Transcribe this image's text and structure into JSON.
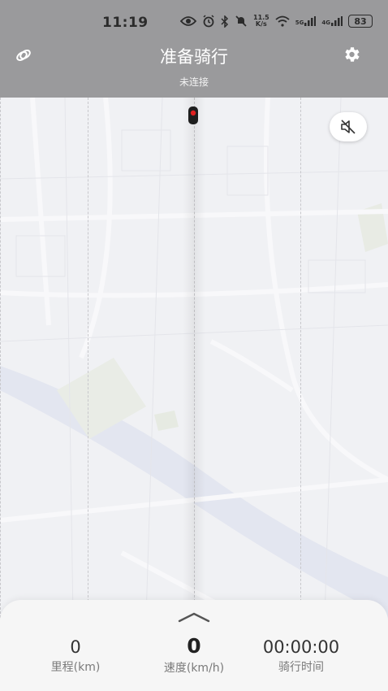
{
  "status": {
    "time": "11:19",
    "net_speed_top": "11.5",
    "net_speed_bottom": "K/s",
    "sig1": "5G",
    "sig2": "4G",
    "battery": "83"
  },
  "header": {
    "title": "准备骑行",
    "subtitle": "未连接",
    "bg_color": "#9a9a9c"
  },
  "icons": {
    "left": "link-icon",
    "right": "gear-icon",
    "mute": "speaker-mute-icon",
    "marker": "location-marker-icon",
    "chevron": "chevron-up-icon"
  },
  "stats": {
    "distance": {
      "value": "0",
      "label": "里程(km)"
    },
    "speed": {
      "value": "0",
      "label": "速度(km/h)"
    },
    "time": {
      "value": "00:00:00",
      "label": "骑行时间"
    }
  }
}
